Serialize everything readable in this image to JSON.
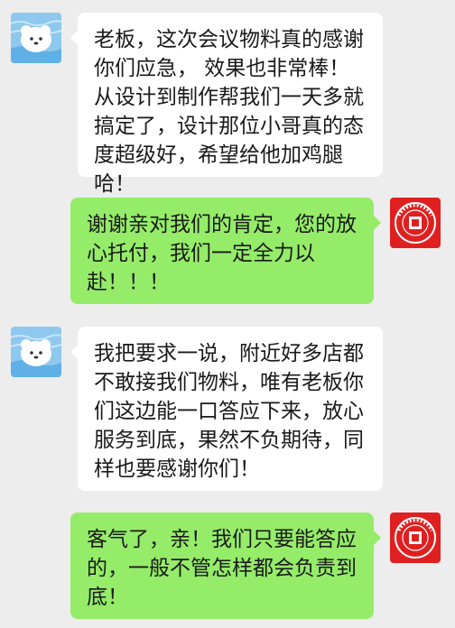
{
  "chat": {
    "messages": [
      {
        "side": "in",
        "text": "老板，这次会议物料真的感谢你们应急， 效果也非常棒！从设计到制作帮我们一天多就搞定了，设计那位小哥真的态度超级好，希望给他加鸡腿哈！"
      },
      {
        "side": "out",
        "text": "谢谢亲对我们的肯定，您的放心托付，我们一定全力以赴！！！"
      },
      {
        "side": "in",
        "text": "我把要求一说，附近好多店都不敢接我们物料，唯有老板你们这边能一口答应下来，放心服务到底，果然不负期待，同样也要感谢你们！"
      },
      {
        "side": "out",
        "text": "客气了，亲！我们只要能答应的，一般不管怎样都会负责到底！"
      }
    ]
  },
  "colors": {
    "background": "#ededed",
    "incoming_bubble": "#ffffff",
    "outgoing_bubble": "#95ec69",
    "merchant_avatar": "#e02020",
    "user_avatar": "#8fc8ef"
  },
  "icons": {
    "user_avatar": "cartoon-dog-avatar-icon",
    "merchant_avatar": "company-seal-avatar-icon"
  }
}
